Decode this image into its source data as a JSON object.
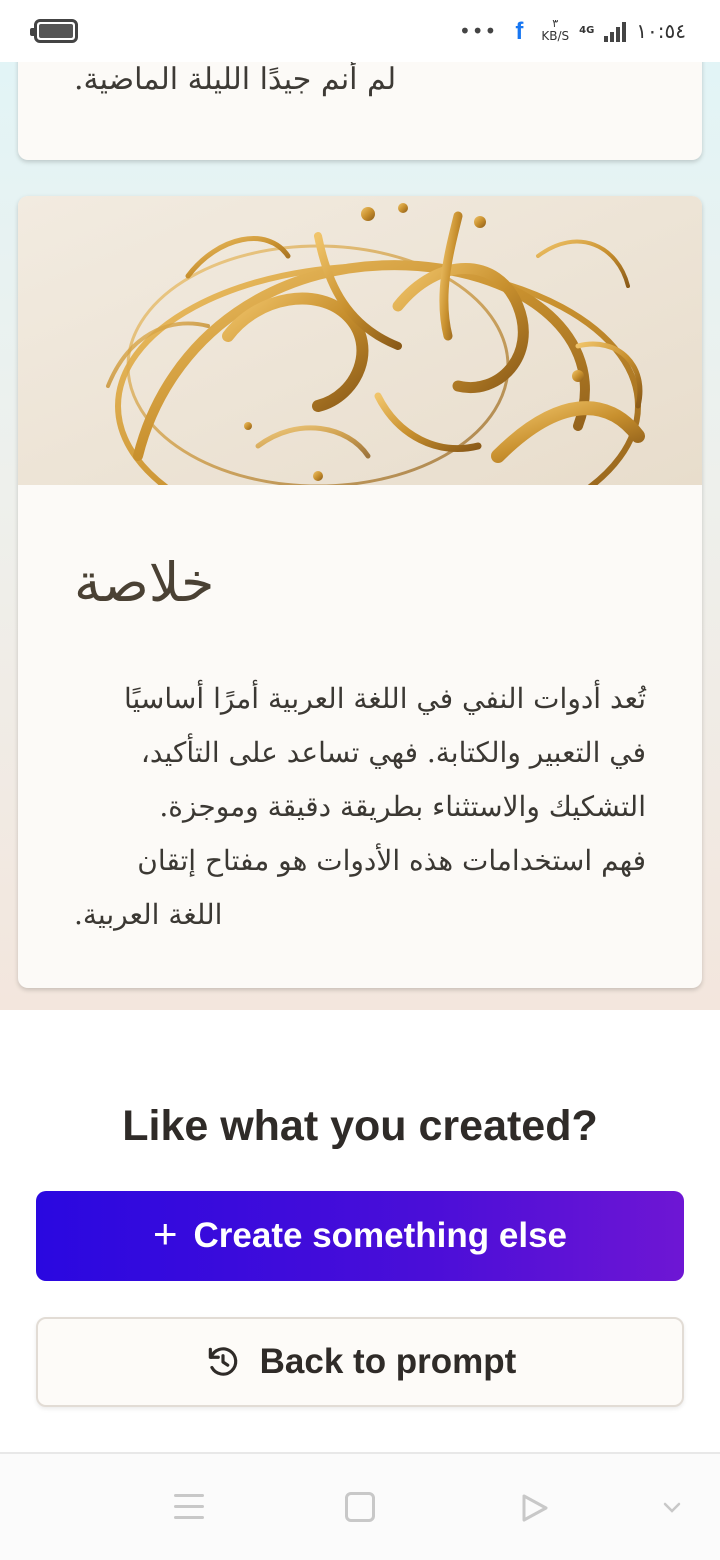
{
  "status_bar": {
    "time": "١٠:٥٤",
    "network": "4G",
    "speed_value": "٣",
    "speed_unit": "KB/S",
    "overflow": "•••",
    "fb_glyph": "f"
  },
  "card_top": {
    "text": "لم أنم جيدًا الليلة الماضية."
  },
  "card_main": {
    "image_alt": "Golden Arabic calligraphy artwork",
    "title": "خلاصة",
    "body_lines": [
      "تُعد أدوات النفي في اللغة العربية أمرًا أساسيًا",
      "في التعبير والكتابة. فهي تساعد على التأكيد،",
      "التشكيك والاستثناء بطريقة دقيقة وموجزة.",
      "فهم استخدامات هذه الأدوات هو مفتاح إتقان",
      "اللغة العربية."
    ]
  },
  "cta": {
    "title": "Like what you created?",
    "create_label": "Create something else",
    "create_icon": "+",
    "back_label": "Back to prompt"
  },
  "colors": {
    "create_gradient_start": "#2a08e0",
    "create_gradient_end": "#6e16d4",
    "card_bg": "#fcfaf7",
    "calligraphy_gold": "#c8902e"
  }
}
